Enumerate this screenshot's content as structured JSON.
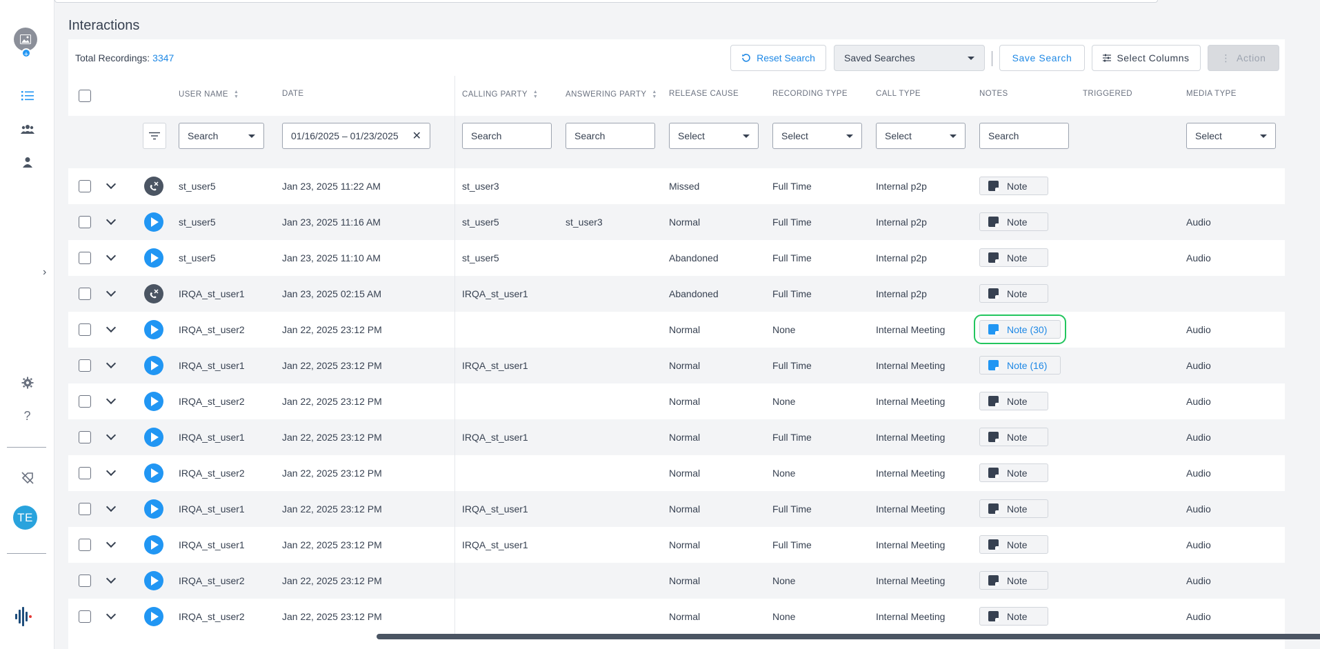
{
  "page_title": "Interactions",
  "toolbar": {
    "total_label": "Total Recordings:",
    "total_count": "3347",
    "reset_label": "Reset Search",
    "saved_searches": "Saved Searches",
    "save_search": "Save Search",
    "select_columns": "Select Columns",
    "action": "Action"
  },
  "columns": {
    "user_name": "USER NAME",
    "date": "DATE",
    "calling_party": "CALLING PARTY",
    "answering_party": "ANSWERING PARTY",
    "release_cause": "RELEASE CAUSE",
    "recording_type": "RECORDING TYPE",
    "call_type": "CALL TYPE",
    "notes": "NOTES",
    "triggered": "TRIGGERED",
    "media_type": "MEDIA TYPE"
  },
  "filters": {
    "user_name": "Search",
    "date": "01/16/2025 – 01/23/2025",
    "calling_party": "Search",
    "answering_party": "Search",
    "release_cause": "Select",
    "recording_type": "Select",
    "call_type": "Select",
    "notes": "Search",
    "media_type": "Select"
  },
  "rows": [
    {
      "status": "missed",
      "user": "st_user5",
      "date": "Jan 23, 2025 11:22 AM",
      "calling": "st_user3",
      "answering": "",
      "release": "Missed",
      "rectype": "Full Time",
      "calltype": "Internal p2p",
      "note": "Note",
      "note_style": "plain",
      "media": ""
    },
    {
      "status": "play",
      "user": "st_user5",
      "date": "Jan 23, 2025 11:16 AM",
      "calling": "st_user5",
      "answering": "st_user3",
      "release": "Normal",
      "rectype": "Full Time",
      "calltype": "Internal p2p",
      "note": "Note",
      "note_style": "plain",
      "media": "Audio"
    },
    {
      "status": "play",
      "user": "st_user5",
      "date": "Jan 23, 2025 11:10 AM",
      "calling": "st_user5",
      "answering": "",
      "release": "Abandoned",
      "rectype": "Full Time",
      "calltype": "Internal p2p",
      "note": "Note",
      "note_style": "plain",
      "media": "Audio"
    },
    {
      "status": "missed",
      "user": "IRQA_st_user1",
      "date": "Jan 23, 2025 02:15 AM",
      "calling": "IRQA_st_user1",
      "answering": "",
      "release": "Abandoned",
      "rectype": "Full Time",
      "calltype": "Internal p2p",
      "note": "Note",
      "note_style": "plain",
      "media": ""
    },
    {
      "status": "play",
      "user": "IRQA_st_user2",
      "date": "Jan 22, 2025 23:12 PM",
      "calling": "",
      "answering": "",
      "release": "Normal",
      "rectype": "None",
      "calltype": "Internal Meeting",
      "note": "Note (30)",
      "note_style": "focus",
      "media": "Audio"
    },
    {
      "status": "play",
      "user": "IRQA_st_user1",
      "date": "Jan 22, 2025 23:12 PM",
      "calling": "IRQA_st_user1",
      "answering": "",
      "release": "Normal",
      "rectype": "Full Time",
      "calltype": "Internal Meeting",
      "note": "Note (16)",
      "note_style": "blue",
      "media": "Audio"
    },
    {
      "status": "play",
      "user": "IRQA_st_user2",
      "date": "Jan 22, 2025 23:12 PM",
      "calling": "",
      "answering": "",
      "release": "Normal",
      "rectype": "None",
      "calltype": "Internal Meeting",
      "note": "Note",
      "note_style": "plain",
      "media": "Audio"
    },
    {
      "status": "play",
      "user": "IRQA_st_user1",
      "date": "Jan 22, 2025 23:12 PM",
      "calling": "IRQA_st_user1",
      "answering": "",
      "release": "Normal",
      "rectype": "Full Time",
      "calltype": "Internal Meeting",
      "note": "Note",
      "note_style": "plain",
      "media": "Audio"
    },
    {
      "status": "play",
      "user": "IRQA_st_user2",
      "date": "Jan 22, 2025 23:12 PM",
      "calling": "",
      "answering": "",
      "release": "Normal",
      "rectype": "None",
      "calltype": "Internal Meeting",
      "note": "Note",
      "note_style": "plain",
      "media": "Audio"
    },
    {
      "status": "play",
      "user": "IRQA_st_user1",
      "date": "Jan 22, 2025 23:12 PM",
      "calling": "IRQA_st_user1",
      "answering": "",
      "release": "Normal",
      "rectype": "Full Time",
      "calltype": "Internal Meeting",
      "note": "Note",
      "note_style": "plain",
      "media": "Audio"
    },
    {
      "status": "play",
      "user": "IRQA_st_user1",
      "date": "Jan 22, 2025 23:12 PM",
      "calling": "IRQA_st_user1",
      "answering": "",
      "release": "Normal",
      "rectype": "Full Time",
      "calltype": "Internal Meeting",
      "note": "Note",
      "note_style": "plain",
      "media": "Audio"
    },
    {
      "status": "play",
      "user": "IRQA_st_user2",
      "date": "Jan 22, 2025 23:12 PM",
      "calling": "",
      "answering": "",
      "release": "Normal",
      "rectype": "None",
      "calltype": "Internal Meeting",
      "note": "Note",
      "note_style": "plain",
      "media": "Audio"
    },
    {
      "status": "play",
      "user": "IRQA_st_user2",
      "date": "Jan 22, 2025 23:12 PM",
      "calling": "",
      "answering": "",
      "release": "Normal",
      "rectype": "None",
      "calltype": "Internal Meeting",
      "note": "Note",
      "note_style": "plain",
      "media": "Audio"
    }
  ],
  "user": {
    "initials": "TE"
  },
  "colors": {
    "accent": "#2196f3",
    "link": "#1e88e5",
    "avatar": "#29a3dd",
    "focus": "#22c55e"
  }
}
